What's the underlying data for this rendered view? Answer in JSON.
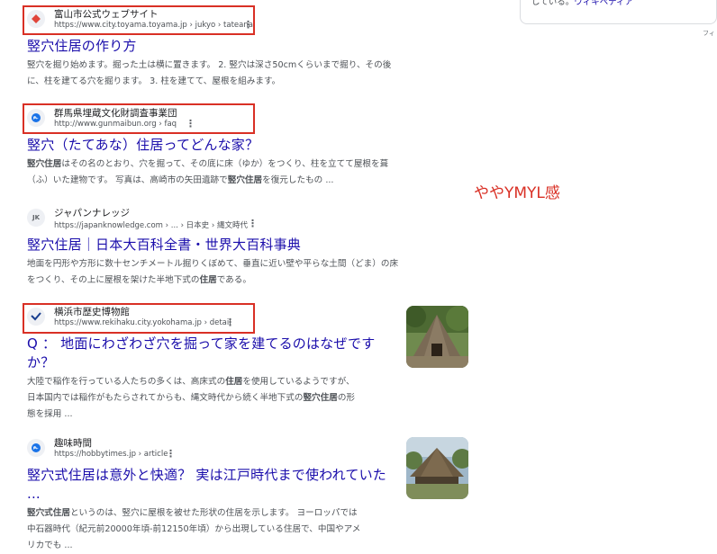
{
  "wiki_panel": {
    "text": "している。",
    "link": "ウィキペディア",
    "footer": "フィ"
  },
  "annotation": "ややYMYL感",
  "results": [
    {
      "site_name": "富山市公式ウェブサイト",
      "url": "https://www.city.toyama.toyama.jp › jukyo › tateana",
      "title": "竪穴住居の作り方",
      "snippet_lines": [
        "竪穴を掘り始めます。掘った土は横に置きます。 2. 竪穴は深さ50cmくらいまで掘り、その後",
        "に、柱を建てる穴を掘ります。 3. 柱を建てて、屋根を組みます。"
      ],
      "icon": "toyama-diamond-icon"
    },
    {
      "site_name": "群馬県埋蔵文化財調査事業団",
      "url": "http://www.gunmaibun.org › faq",
      "title": "竪穴（たてあな）住居ってどんな家？",
      "snippet_lines": [
        "竪穴住居はその名のとおり、穴を掘って、その底に床（ゆか）をつくり、柱を立てて屋根を葺",
        "（ふ）いた建物です。 写真は、高崎市の矢田遺跡で竪穴住居を復元したもの ..."
      ],
      "icon": "globe-icon"
    },
    {
      "site_name": "ジャパンナレッジ",
      "url": "https://japanknowledge.com › ... › 日本史 › 縄文時代",
      "title": "竪穴住居｜日本大百科全書・世界大百科事典",
      "snippet_lines": [
        "地面を円形や方形に数十センチメートル掘りくぼめて、垂直に近い壁や平らな土間（どま）の床",
        "をつくり、その上に屋根を架けた半地下式の住居である。"
      ],
      "icon_text": "JK"
    },
    {
      "site_name": "横浜市歴史博物館",
      "url": "https://www.rekihaku.city.yokohama.jp › detail",
      "title_lines": [
        "Q ： 地面にわざわざ穴を掘って家を建てるのはなぜです",
        "か？"
      ],
      "snippet_lines": [
        "大陸で稲作を行っている人たちの多くは、高床式の住居を使用しているようですが、",
        "日本国内では稲作がもたらされてからも、縄文時代から続く半地下式の竪穴住居の形",
        "態を採用 ..."
      ],
      "icon": "yokohama-check-icon"
    },
    {
      "site_name": "趣味時間",
      "url": "https://hobbytimes.jp › article",
      "title_lines": [
        "竪穴式住居は意外と快適？ 実は江戸時代まで使われていた",
        "..."
      ],
      "snippet_lines": [
        "竪穴式住居というのは、竪穴に屋根を被せた形状の住居を示します。 ヨーロッパでは",
        "中石器時代（紀元前20000年頃-前12150年頃）から出現している住居で、中国やアメ",
        "リカでも ..."
      ],
      "icon": "globe-icon"
    }
  ],
  "kebab_glyph": "⋮"
}
